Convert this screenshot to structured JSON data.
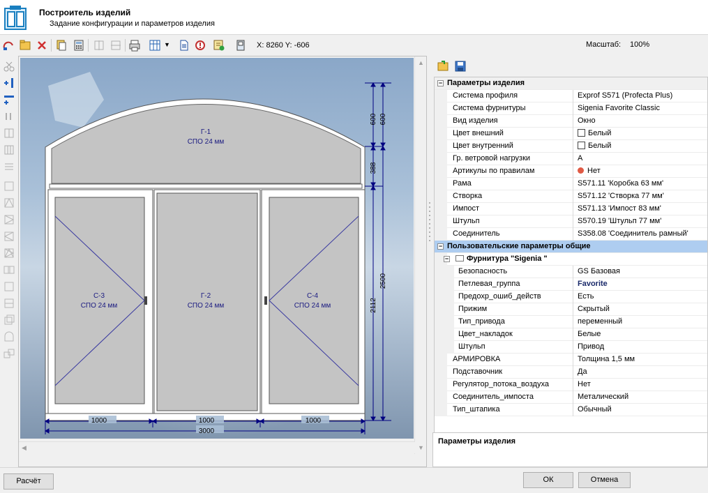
{
  "header": {
    "title": "Построитель изделий",
    "subtitle": "Задание конфигурации и параметров изделия"
  },
  "toolbar": {
    "coords": "X: 8260  Y: -606",
    "scale_label": "Масштаб:",
    "scale_value": "100%"
  },
  "drawing": {
    "panels": {
      "g1": {
        "name": "Г-1",
        "glass": "СПО 24 мм"
      },
      "g2": {
        "name": "Г-2",
        "glass": "СПО 24 мм"
      },
      "c3": {
        "name": "С-3",
        "glass": "СПО 24 мм"
      },
      "c4": {
        "name": "С-4",
        "glass": "СПО 24 мм"
      }
    },
    "dims": {
      "w_left": "1000",
      "w_mid": "1000",
      "w_right": "1000",
      "w_total": "3000",
      "h_arc1": "600",
      "h_arc2": "600",
      "h_transom": "388",
      "h_lower": "2112",
      "h_total": "2500"
    }
  },
  "properties": {
    "cat1": "Параметры изделия",
    "rows1": [
      {
        "name": "Система профиля",
        "value": "Exprof S571 (Profecta Plus)"
      },
      {
        "name": "Система фурнитуры",
        "value": "Sigenia Favorite Classic"
      },
      {
        "name": "Вид изделия",
        "value": "Окно"
      },
      {
        "name": "Цвет внешний",
        "value": "Белый"
      },
      {
        "name": "Цвет внутренний",
        "value": "Белый"
      },
      {
        "name": "Гр. ветровой нагрузки",
        "value": "A"
      },
      {
        "name": "Артикулы по правилам",
        "value": "Нет"
      },
      {
        "name": "Рама",
        "value": "S571.11 'Коробка 63 мм'"
      },
      {
        "name": "Створка",
        "value": "S571.12 'Створка 77 мм'"
      },
      {
        "name": "Импост",
        "value": "S571.13 'Импост 83 мм'"
      },
      {
        "name": "Штульп",
        "value": "S570.19 'Штульп 77 мм'"
      },
      {
        "name": "Соединитель",
        "value": "S358.08 'Соединитель рамный'"
      }
    ],
    "cat2": "Пользовательские параметры общие",
    "sub": "Фурнитура \"Sigenia \"",
    "rows2": [
      {
        "name": "Безопасность",
        "value": "GS Базовая"
      },
      {
        "name": "Петлевая_группа",
        "value": "Favorite"
      },
      {
        "name": "Предохр_ошиб_действ",
        "value": "Есть"
      },
      {
        "name": "Прижим",
        "value": "Скрытый"
      },
      {
        "name": "Тип_привода",
        "value": "переменный"
      },
      {
        "name": "Цвет_накладок",
        "value": "Белые"
      },
      {
        "name": "Штульп",
        "value": "Привод"
      }
    ],
    "rows3": [
      {
        "name": "АРМИРОВКА",
        "value": "Толщина 1,5 мм"
      },
      {
        "name": "Подставочник",
        "value": "Да"
      },
      {
        "name": "Регулятор_потока_воздуха",
        "value": "Нет"
      },
      {
        "name": "Соединитель_импоста",
        "value": "Металический"
      },
      {
        "name": "Тип_штапика",
        "value": "Обычный"
      }
    ],
    "description_title": "Параметры изделия"
  },
  "buttons": {
    "calc": "Расчёт",
    "ok": "ОК",
    "cancel": "Отмена"
  },
  "colors": {
    "accent_selection": "#aecdf0",
    "dim_lines": "#000080",
    "glass": "#c4c4c4",
    "frame": "#ffffff"
  }
}
